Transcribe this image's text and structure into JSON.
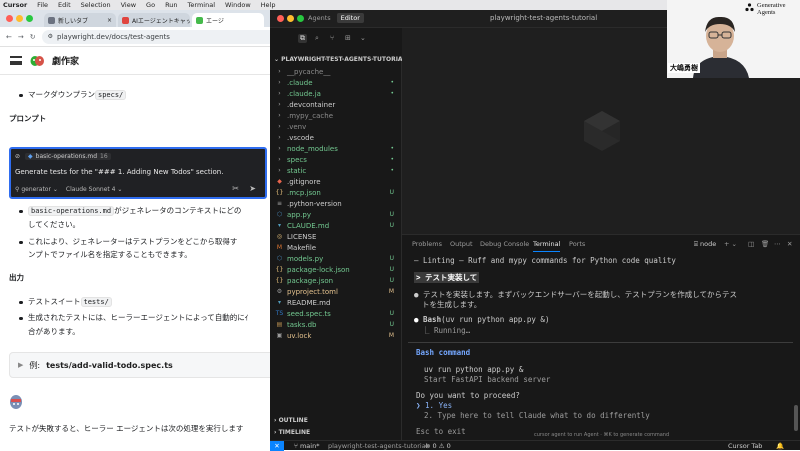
{
  "menubar": {
    "items": [
      "Cursor",
      "File",
      "Edit",
      "Selection",
      "View",
      "Go",
      "Run",
      "Terminal",
      "Window",
      "Help"
    ]
  },
  "browser": {
    "tabs": [
      {
        "label": "新しいタブ",
        "favicon_color": "#6b7280"
      },
      {
        "label": "AIエージェントキャッチアップ #",
        "favicon_color": "#e0443e"
      },
      {
        "label": "エージ",
        "favicon_color": "#45ba4b"
      }
    ],
    "url": "playwright.dev/docs/test-agents",
    "site_title": "劇作家",
    "content": {
      "bullet_markdown": "マークダウンプラン",
      "bullet_markdown_code": "specs/",
      "heading_prompt": "プロンプト",
      "copilot": {
        "file_name": "basic-operations.md",
        "file_line": "16",
        "prompt_text": "Generate tests for the \"### 1. Adding New Todos\" section.",
        "mode": "generator",
        "model": "Claude Sonnet 4"
      },
      "bullet2_code": "basic-operations.md",
      "bullet2_text_a": "がジェネレータのコンテキストにどの",
      "bullet2_text_b": "してください。",
      "bullet3_text_a": "これにより、ジェネレーターはテストプランをどこから取得す",
      "bullet3_text_b": "ンプトでファイル名を指定することもできます。",
      "heading_output": "出力",
      "bullet4_text": "テストスイート",
      "bullet4_code": "tests/",
      "bullet5_text_a": "生成されたテストには、ヒーラーエージェントによって自動的にｲ",
      "bullet5_text_b": "合があります。",
      "details_prefix": "例:",
      "details_label": "tests/add-valid-todo.spec.ts",
      "footer_text": "テストが失敗すると、ヒーラー エージェントは次の処理を実行します"
    }
  },
  "vscode": {
    "tabs": [
      "Agents",
      "Editor"
    ],
    "window_title": "playwright-test-agents-tutorial",
    "explorer_title": "PLAYWRIGHT-TEST-AGENTS-TUTORIAL",
    "files": [
      {
        "name": "__pycache__",
        "icon": "chevron",
        "color": "#8b8b8b",
        "badge": ""
      },
      {
        "name": ".claude",
        "icon": "chevron",
        "color": "#73c991",
        "badge": "•"
      },
      {
        "name": ".claude.ja",
        "icon": "chevron",
        "color": "#73c991",
        "badge": "•"
      },
      {
        "name": ".devcontainer",
        "icon": "chevron",
        "color": "#cccccc",
        "badge": ""
      },
      {
        "name": ".mypy_cache",
        "icon": "chevron",
        "color": "#8b8b8b",
        "badge": ""
      },
      {
        "name": ".venv",
        "icon": "chevron",
        "color": "#8b8b8b",
        "badge": ""
      },
      {
        "name": ".vscode",
        "icon": "chevron",
        "color": "#cccccc",
        "badge": ""
      },
      {
        "name": "node_modules",
        "icon": "chevron",
        "color": "#73c991",
        "badge": "•"
      },
      {
        "name": "specs",
        "icon": "chevron",
        "color": "#73c991",
        "badge": "•"
      },
      {
        "name": "static",
        "icon": "chevron",
        "color": "#73c991",
        "badge": "•"
      },
      {
        "name": ".gitignore",
        "icon": "git",
        "color": "#cccccc",
        "badge": ""
      },
      {
        "name": ".mcp.json",
        "icon": "json",
        "color": "#73c991",
        "badge": "U"
      },
      {
        "name": ".python-version",
        "icon": "file",
        "color": "#cccccc",
        "badge": ""
      },
      {
        "name": "app.py",
        "icon": "py",
        "color": "#73c991",
        "badge": "U"
      },
      {
        "name": "CLAUDE.md",
        "icon": "md",
        "color": "#73c991",
        "badge": "U"
      },
      {
        "name": "LICENSE",
        "icon": "lic",
        "color": "#cccccc",
        "badge": ""
      },
      {
        "name": "Makefile",
        "icon": "make",
        "color": "#cccccc",
        "badge": ""
      },
      {
        "name": "models.py",
        "icon": "py",
        "color": "#73c991",
        "badge": "U"
      },
      {
        "name": "package-lock.json",
        "icon": "json",
        "color": "#73c991",
        "badge": "U"
      },
      {
        "name": "package.json",
        "icon": "json",
        "color": "#73c991",
        "badge": "U"
      },
      {
        "name": "pyproject.toml",
        "icon": "toml",
        "color": "#e2c08d",
        "badge": "M"
      },
      {
        "name": "README.md",
        "icon": "md",
        "color": "#cccccc",
        "badge": ""
      },
      {
        "name": "seed.spec.ts",
        "icon": "ts",
        "color": "#73c991",
        "badge": "U"
      },
      {
        "name": "tasks.db",
        "icon": "db",
        "color": "#73c991",
        "badge": "U"
      },
      {
        "name": "uv.lock",
        "icon": "lock",
        "color": "#e2c08d",
        "badge": "M"
      }
    ],
    "outline_label": "OUTLINE",
    "timeline_label": "TIMELINE",
    "panel_tabs": [
      "Problems",
      "Output",
      "Debug Console",
      "Terminal",
      "Ports"
    ],
    "terminal_name": "node",
    "terminal": {
      "line1": "– Linting – Ruff and mypy commands for Python code quality",
      "prompt_line": "> テスト実装して",
      "status_line_a": "● テストを実装します。まずバックエンドサーバーを起動し、テストプランを作成してからテス",
      "status_line_b": "トを生成します。",
      "bash_label": "Bash",
      "bash_cmd": "(uv run python app.py &)",
      "running": "⎿ Running…",
      "box_title": "Bash command",
      "box_cmd": "uv run python app.py &",
      "box_desc": "Start FastAPI backend server",
      "question": "Do you want to proceed?",
      "option1": "❯ 1. Yes",
      "option2": "2. Type here to tell Claude what to do differently",
      "esc": "Esc to exit",
      "hint": "cursor agent to run Agent · ⌘K to generate command"
    },
    "status": {
      "branch": "main*",
      "project": "playwright-test-agents-tutorial",
      "errors": "0",
      "warnings": "0",
      "right": "Cursor Tab"
    }
  },
  "webcam": {
    "name_tag": "大嶋勇樹",
    "logo_line1": "Generative",
    "logo_line2": "Agents"
  }
}
